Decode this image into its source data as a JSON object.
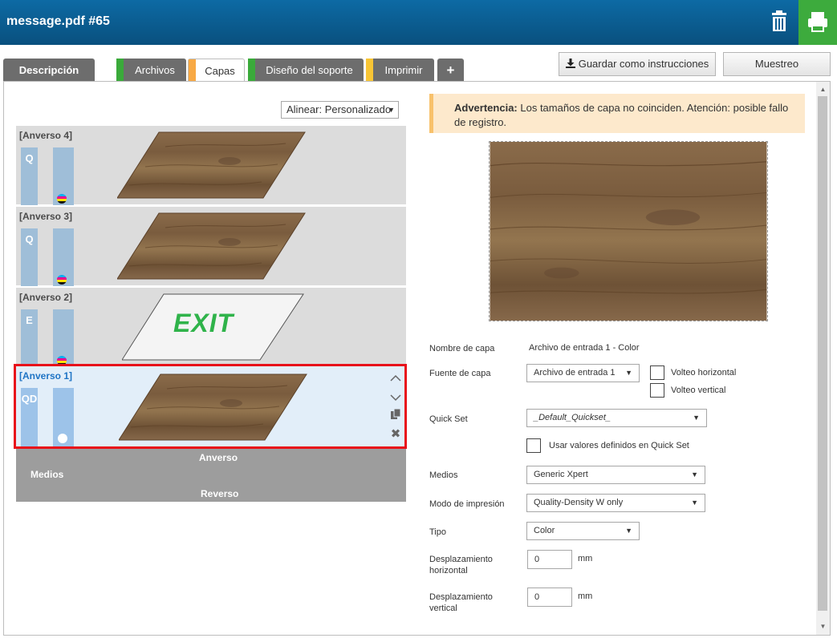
{
  "window": {
    "title": "message.pdf #65"
  },
  "tabs": [
    {
      "label": "Descripción"
    },
    {
      "label": "Archivos",
      "marker_color": "#3aaa3a"
    },
    {
      "label": "Capas",
      "marker_color": "#f8a944"
    },
    {
      "label": "Diseño del soporte",
      "marker_color": "#3aaa3a"
    },
    {
      "label": "Imprimir",
      "marker_color": "#f8c534"
    },
    {
      "label": "+"
    }
  ],
  "toolbar": {
    "save_label": "Guardar como instrucciones",
    "sample_label": "Muestreo"
  },
  "align": {
    "value": "Alinear: Personalizado"
  },
  "layers": [
    {
      "name": "[Anverso 4]",
      "mode": "Q",
      "content": "wood",
      "ink": "cmyk"
    },
    {
      "name": "[Anverso 3]",
      "mode": "Q",
      "content": "wood",
      "ink": "cmyk"
    },
    {
      "name": "[Anverso 2]",
      "mode": "E",
      "content": "exit",
      "ink": "cmyk",
      "exit_text": "EXIT"
    },
    {
      "name": "[Anverso 1]",
      "mode": "QD",
      "content": "wood",
      "ink": "white",
      "selected": true
    }
  ],
  "media": {
    "label": "Medios",
    "front": "Anverso",
    "back": "Reverso"
  },
  "warning": {
    "title": "Advertencia:",
    "text": "Los tamaños de capa no coinciden. Atención: posible fallo de registro."
  },
  "form": {
    "layer_name": {
      "label": "Nombre de capa",
      "value": "Archivo de entrada 1 - Color"
    },
    "layer_source": {
      "label": "Fuente de capa",
      "value": "Archivo de entrada 1"
    },
    "flip_h": {
      "label": "Volteo horizontal",
      "checked": false
    },
    "flip_v": {
      "label": "Volteo vertical",
      "checked": false
    },
    "quick_set": {
      "label": "Quick Set",
      "value": "_Default_Quickset_"
    },
    "use_quickset": {
      "label": "Usar valores definidos en Quick Set",
      "checked": false
    },
    "media": {
      "label": "Medios",
      "value": "Generic Xpert"
    },
    "print_mode": {
      "label": "Modo de impresión",
      "value": "Quality-Density W only"
    },
    "type": {
      "label": "Tipo",
      "value": "Color"
    },
    "offset_h": {
      "label": "Desplazamiento horizontal",
      "value": "0",
      "unit": "mm"
    },
    "offset_v": {
      "label": "Desplazamiento vertical",
      "value": "0",
      "unit": "mm"
    }
  },
  "colors": {
    "header": "#0b5e94",
    "print_button": "#3dab3d",
    "selection_border": "#e8101a",
    "exit_green": "#2fb34a"
  }
}
